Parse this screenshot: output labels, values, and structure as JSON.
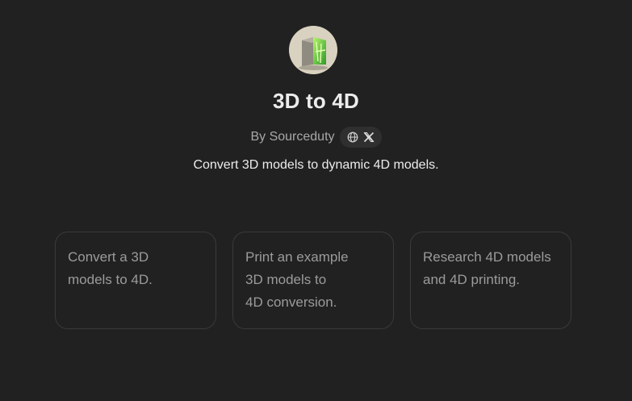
{
  "gpt": {
    "title": "3D to 4D",
    "author": "By Sourceduty",
    "description": "Convert 3D models to dynamic 4D models."
  },
  "social": {
    "icons": [
      "globe-icon",
      "x-icon"
    ]
  },
  "prompts": [
    {
      "text": "Convert a 3D\nmodels to 4D."
    },
    {
      "text": "Print an example\n3D models to\n4D conversion."
    },
    {
      "text": "Research 4D models\nand 4D printing."
    }
  ],
  "colors": {
    "background": "#212121",
    "card_border": "#3a3a3a",
    "pill_background": "#2f2f2f",
    "muted_text": "#9b9b9b"
  }
}
